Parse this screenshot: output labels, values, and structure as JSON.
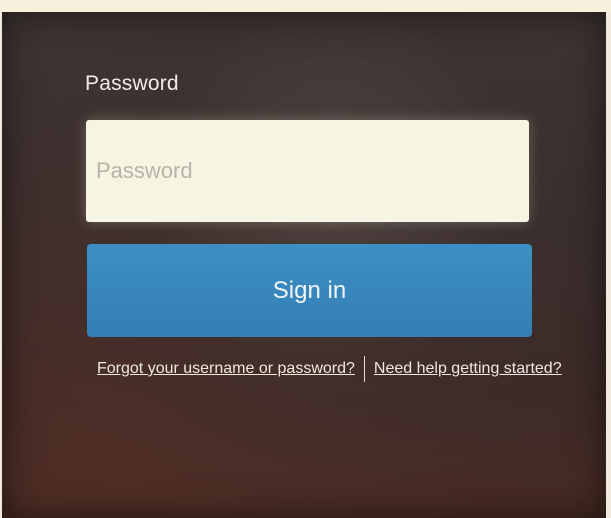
{
  "login": {
    "password_label": "Password",
    "password_placeholder": "Password",
    "password_value": "",
    "signin_label": "Sign in",
    "forgot_link": "Forgot your username or password?",
    "help_link": "Need help getting started?"
  },
  "colors": {
    "background": "#3a2f2e",
    "input_background": "#f6f4e2",
    "button": "#3785bb",
    "text_light": "#f1ece6"
  }
}
